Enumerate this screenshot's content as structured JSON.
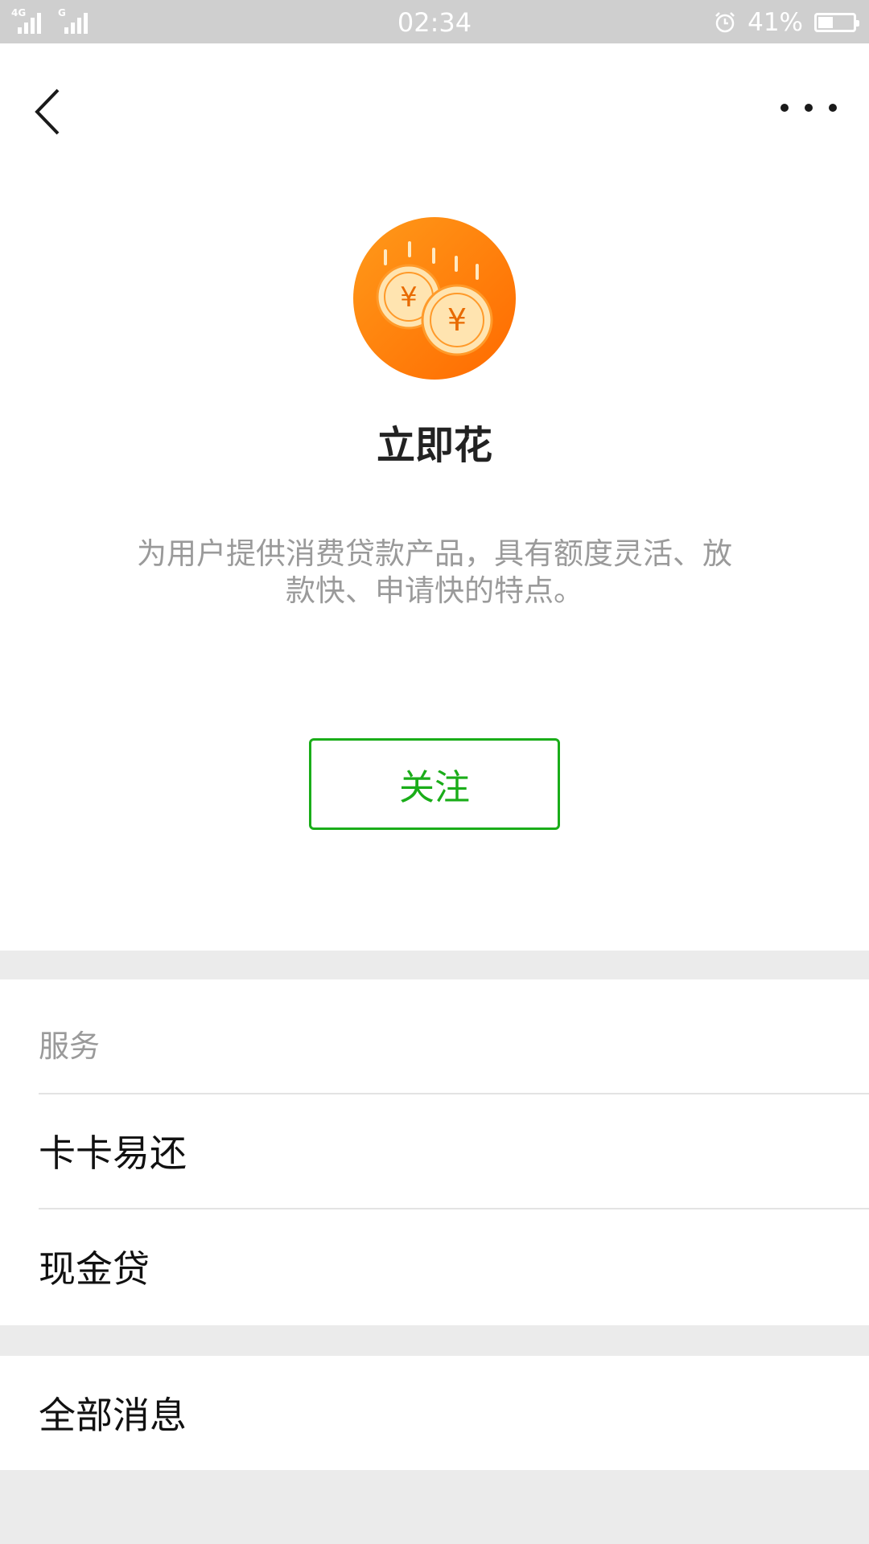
{
  "status_bar": {
    "network1": "4G",
    "network2": "G",
    "time": "02:34",
    "battery_percent": "41%",
    "battery_level": 0.41
  },
  "nav": {
    "back_icon": "chevron-left-icon",
    "more_icon": "more-horizontal-icon"
  },
  "profile": {
    "logo_icon": "yuan-coins-logo",
    "name": "立即花",
    "description": "为用户提供消费贷款产品，具有额度灵活、放款快、申请快的特点。",
    "follow_label": "关注",
    "accent_color": "#1aad19",
    "logo_color": "#ff7a00"
  },
  "services": {
    "label": "服务",
    "items": [
      {
        "label": "卡卡易还"
      },
      {
        "label": "现金贷"
      }
    ]
  },
  "messages": {
    "all_label": "全部消息"
  }
}
